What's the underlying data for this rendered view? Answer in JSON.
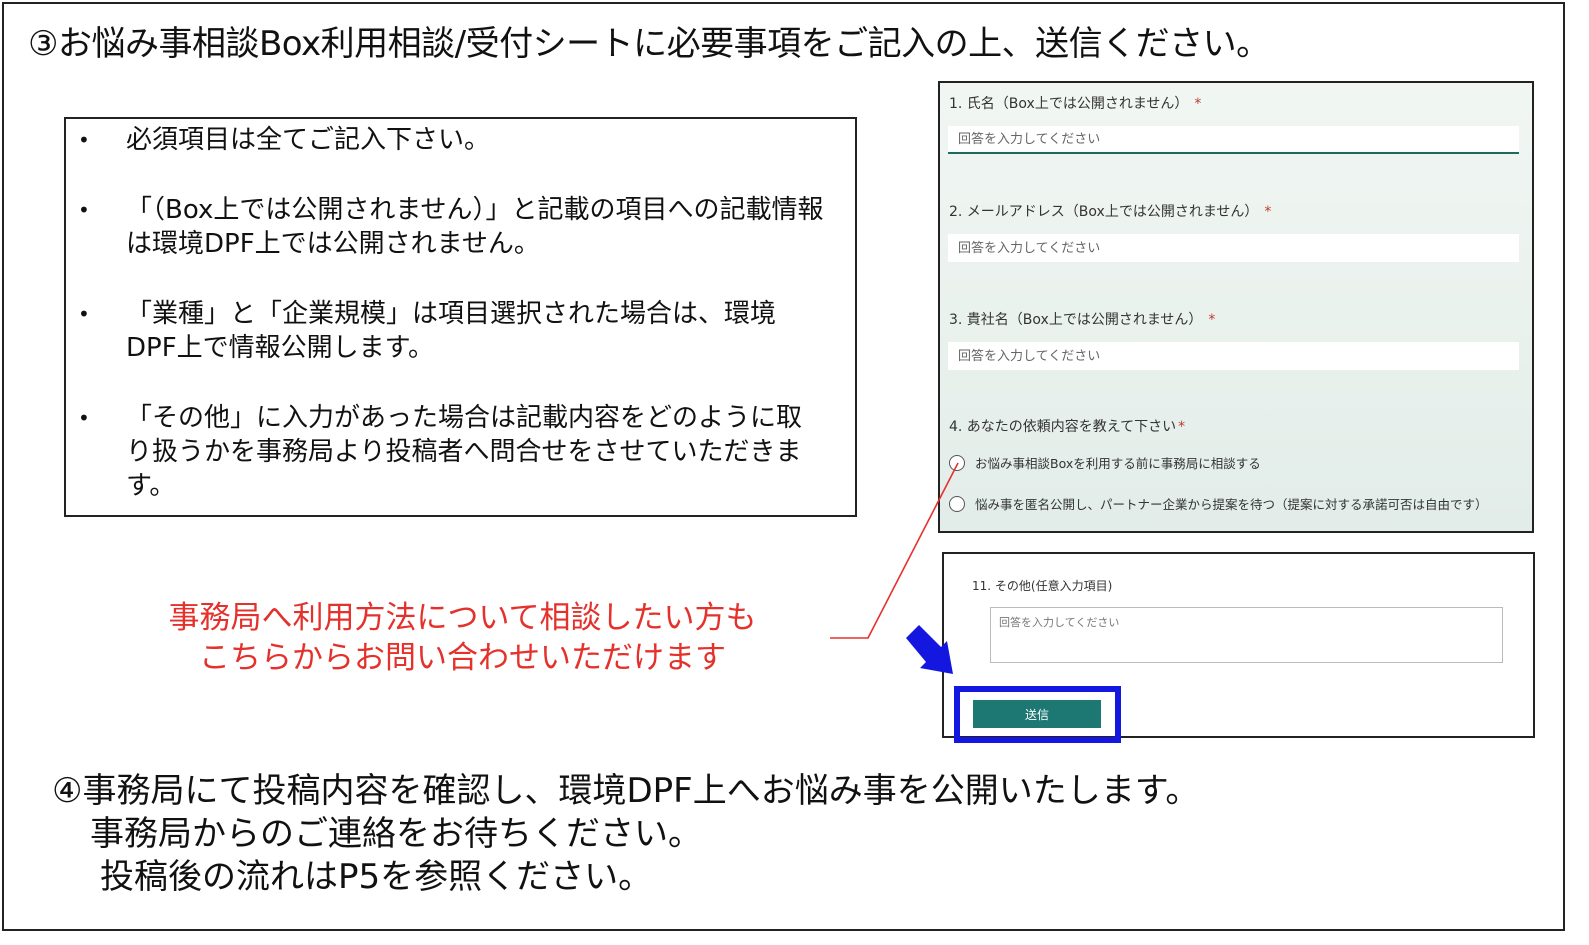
{
  "title": "③お悩み事相談Box利用相談/受付シートに必要事項をご記入の上、送信ください。",
  "notes": [
    "必須項目は全てご記入下さい。",
    "「（Box上では公開されません）」と記載の項目への記載情報は環境DPF上では公開されません。",
    "「業種」と「企業規模」は項目選択された場合は、環境DPF上で情報公開します。",
    "「その他」に入力があった場合は記載内容をどのように取り扱うかを事務局より投稿者へ問合せをさせていただきます。"
  ],
  "bullet": "•",
  "form": {
    "q1_label": "1. 氏名（Box上では公開されません）",
    "q2_label": "2. メールアドレス（Box上では公開されません）",
    "q3_label": "3. 貴社名（Box上では公開されません）",
    "q4_label": "4. あなたの依頼内容を教えて下さい",
    "required_mark": "*",
    "placeholder": "回答を入力してください",
    "q4_option1": "お悩み事相談Boxを利用する前に事務局に相談する",
    "q4_option2": "悩み事を匿名公開し、パートナー企業から提案を待つ（提案に対する承諾可否は自由です）",
    "q11_label": "11. その他(任意入力項目)",
    "submit_label": "送信"
  },
  "red_note": {
    "line1": "事務局へ利用方法について相談したい方も",
    "line2": "こちらからお問い合わせいただけます"
  },
  "step4": {
    "line1": "④事務局にて投稿内容を確認し、環境DPF上へお悩み事を公開いたします。",
    "line2": "事務局からのご連絡をお待ちください。",
    "line3": "投稿後の流れはP5を参照ください。"
  },
  "colors": {
    "accent_red": "#e5312b",
    "submit_green": "#1d7773",
    "highlight_blue": "#1417e0"
  },
  "icons": {
    "pointer": "arrow-down-right-icon"
  }
}
